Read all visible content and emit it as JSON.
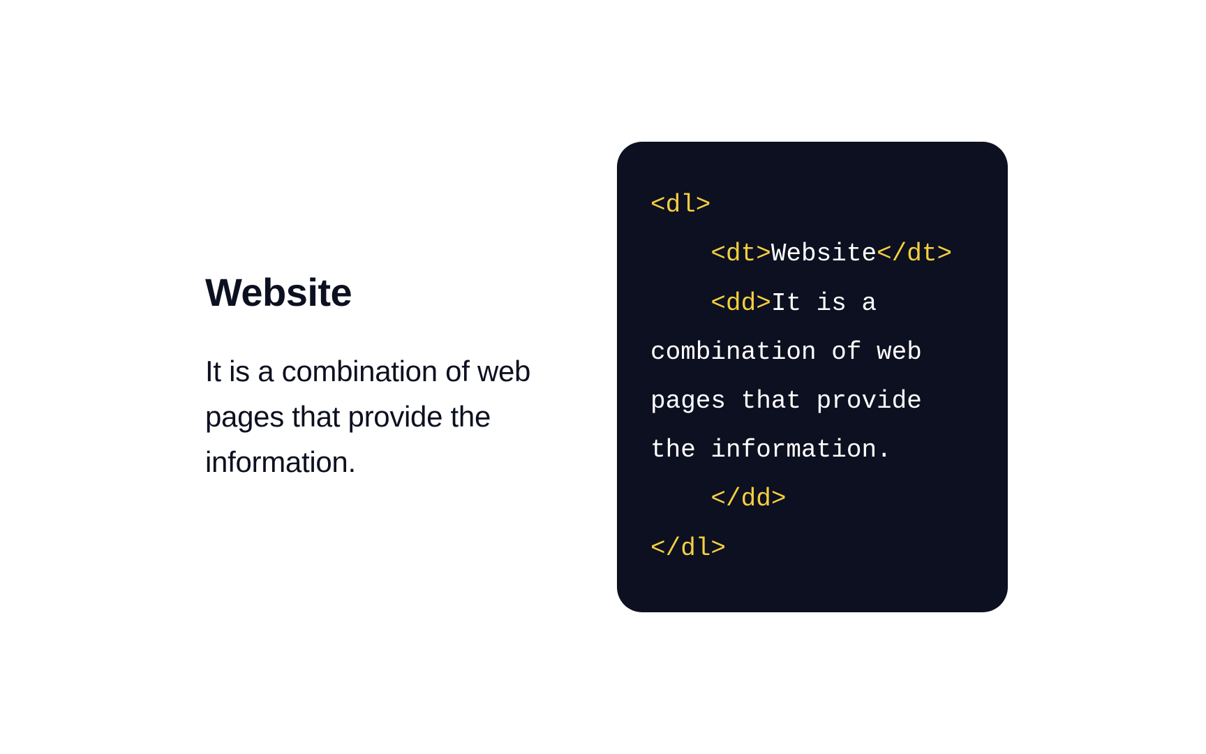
{
  "left": {
    "term": "Website",
    "definition": "It is a combination of web pages that provide the information."
  },
  "code": {
    "line1_tag": "<dl>",
    "line2_indent": "    ",
    "line2_open": "<dt>",
    "line2_text": "Website",
    "line2_close": "</dt>",
    "line3_indent": "    ",
    "line3_open": "<dd>",
    "line3_text_part1": "It is a ",
    "line3_text_part2": "combination of web pages that provide the information.",
    "line4_indent": "    ",
    "line4_close": "</dd>",
    "line5_tag": "</dl>"
  }
}
